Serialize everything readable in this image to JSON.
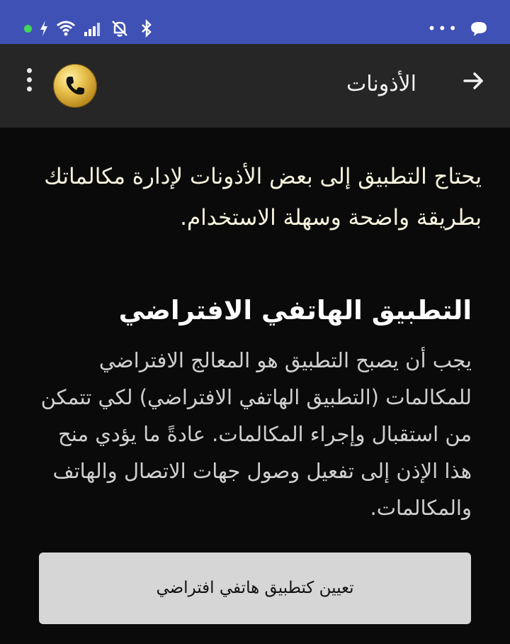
{
  "status_bar": {
    "left_icons": [
      "online-dot",
      "charging-bolt-icon",
      "wifi-icon",
      "signal-bars-icon",
      "bell-off-icon",
      "bluetooth-icon"
    ],
    "right_icons": [
      "more-dots-icon",
      "chat-bubble-icon"
    ],
    "overflow": "•••"
  },
  "toolbar": {
    "title": "الأذونات",
    "back_icon": "arrow-right-icon",
    "logo_icon": "phone-handset-icon",
    "menu_icon": "overflow-menu-icon"
  },
  "intro": {
    "text": "يحتاج التطبيق إلى بعض الأذونات لإدارة مكالماتك بطريقة واضحة وسهلة الاستخدام."
  },
  "section": {
    "title": "التطبيق الهاتفي الافتراضي",
    "body": "يجب أن يصبح التطبيق هو المعالج الافتراضي للمكالمات (التطبيق الهاتفي الافتراضي) لكي تتمكن من استقبال وإجراء المكالمات. عادةً ما يؤدي منح هذا الإذن إلى تفعيل وصول جهات الاتصال والهاتف والمكالمات."
  },
  "button": {
    "label": "تعيين كتطبيق هاتفي افتراضي"
  },
  "colors": {
    "status_bar": "#3f51b5",
    "toolbar": "#262626",
    "background": "#0a0a0a",
    "intro_text": "#f7f3dd",
    "button_bg": "#d6d6d6",
    "online_dot": "#43d658"
  }
}
